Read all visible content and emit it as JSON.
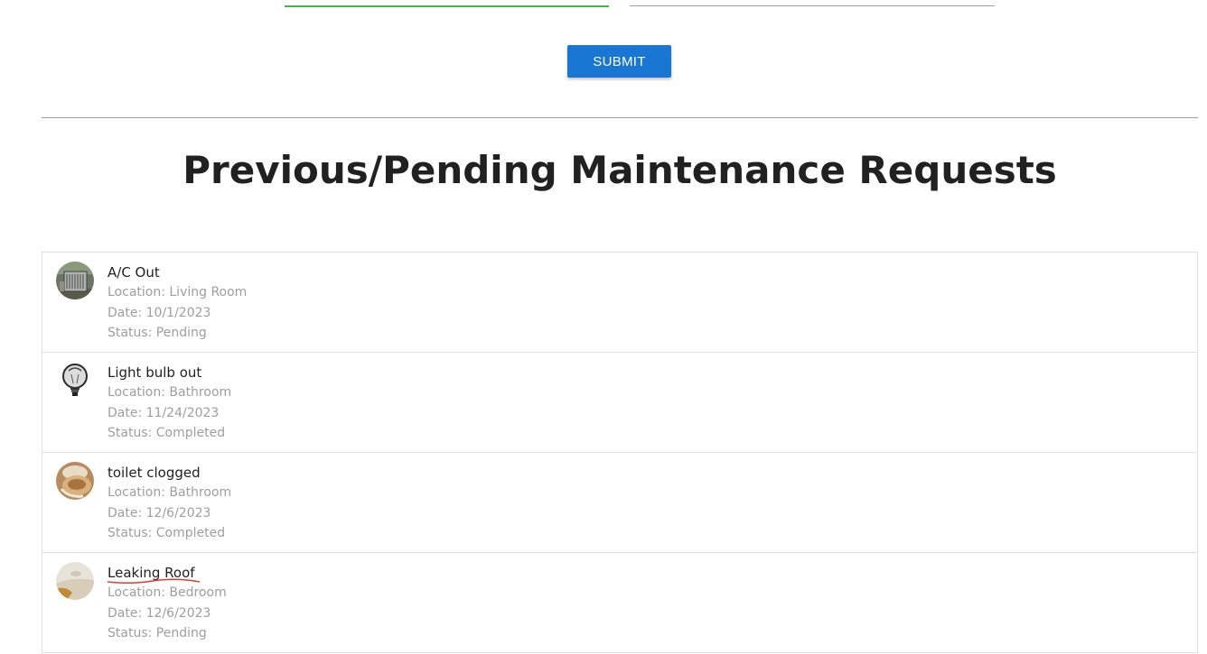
{
  "form": {
    "submit_label": "SUBMIT"
  },
  "section": {
    "title": "Previous/Pending Maintenance Requests"
  },
  "requests": [
    {
      "title": "A/C Out",
      "location": "Location: Living Room",
      "date": "Date: 10/1/2023",
      "status": "Status: Pending",
      "icon": "ac-unit-photo"
    },
    {
      "title": "Light bulb out",
      "location": "Location: Bathroom",
      "date": "Date: 11/24/2023",
      "status": "Status: Completed",
      "icon": "light-bulb-photo"
    },
    {
      "title": "toilet clogged",
      "location": "Location: Bathroom",
      "date": "Date: 12/6/2023",
      "status": "Status: Completed",
      "icon": "toilet-photo"
    },
    {
      "title": "Leaking Roof",
      "location": "Location: Bedroom",
      "date": "Date: 12/6/2023",
      "status": "Status: Pending",
      "icon": "roof-leak-photo"
    }
  ],
  "colors": {
    "accent": "#1976d2",
    "active_input": "#4caf50",
    "muted_text": "#9e9e9e",
    "spellcheck": "#e53935"
  }
}
